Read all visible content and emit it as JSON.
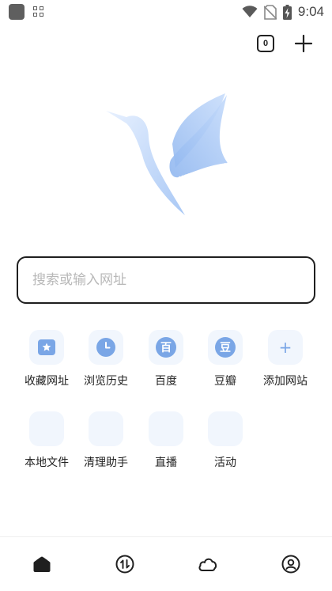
{
  "status_bar": {
    "time": "9:04",
    "icons": [
      "app-icon",
      "grid-icon",
      "wifi-icon",
      "no-sim-icon",
      "battery-charging-icon"
    ]
  },
  "top": {
    "tab_count": "0",
    "add_tab_icon": "plus-icon"
  },
  "search": {
    "placeholder": "搜索或输入网址",
    "value": ""
  },
  "shortcuts": [
    {
      "label": "收藏网址",
      "icon": "star-bookmark-icon"
    },
    {
      "label": "浏览历史",
      "icon": "clock-icon"
    },
    {
      "label": "百度",
      "icon": "baidu-icon",
      "glyph": "百"
    },
    {
      "label": "豆瓣",
      "icon": "douban-icon",
      "glyph": "豆"
    },
    {
      "label": "添加网站",
      "icon": "add-icon",
      "glyph": "+"
    },
    {
      "label": "本地文件",
      "icon": "folder-icon"
    },
    {
      "label": "清理助手",
      "icon": "broom-icon"
    },
    {
      "label": "直播",
      "icon": "live-icon"
    },
    {
      "label": "活动",
      "icon": "activity-icon"
    }
  ],
  "bottom_nav": [
    {
      "name": "home",
      "icon": "home-icon",
      "active": true
    },
    {
      "name": "transfer",
      "icon": "transfer-icon",
      "active": false
    },
    {
      "name": "cloud",
      "icon": "cloud-icon",
      "active": false
    },
    {
      "name": "profile",
      "icon": "profile-icon",
      "active": false
    }
  ],
  "colors": {
    "accent": "#7aa6e6",
    "tile_bg": "#f1f6fd",
    "text": "#222222",
    "placeholder": "#b8b8b8"
  }
}
